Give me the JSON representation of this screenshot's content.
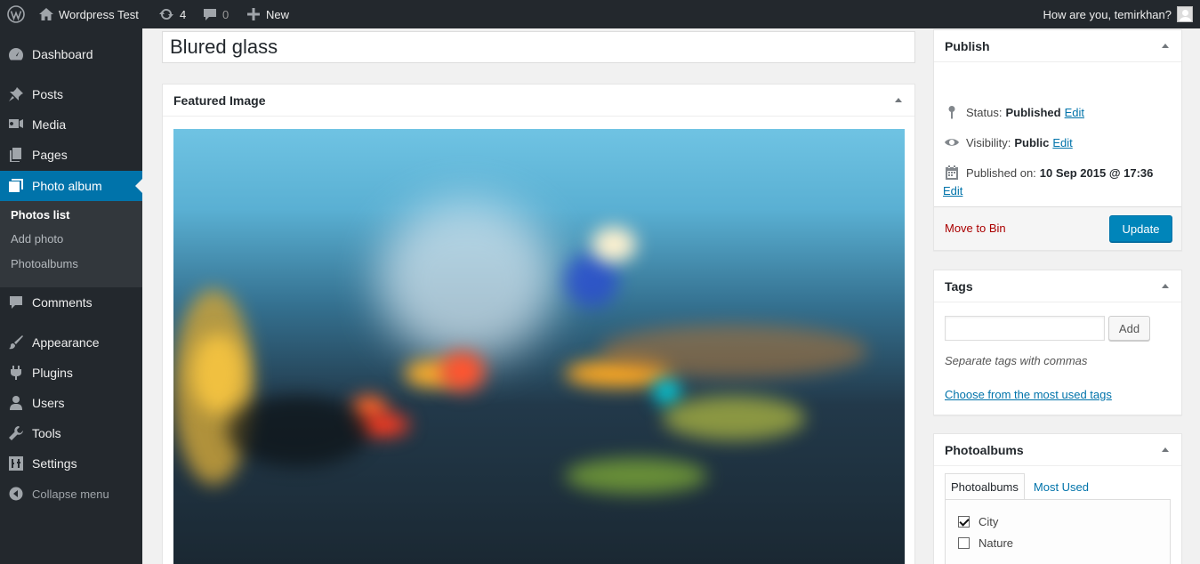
{
  "adminbar": {
    "site_name": "Wordpress Test",
    "updates_count": "4",
    "comments_count": "0",
    "new_label": "New",
    "howdy": "How are you, temirkhan?"
  },
  "sidebar": {
    "items": [
      {
        "label": "Dashboard",
        "icon": "dashboard-icon"
      },
      {
        "label": "Posts",
        "icon": "pushpin-icon"
      },
      {
        "label": "Media",
        "icon": "media-icon"
      },
      {
        "label": "Pages",
        "icon": "pages-icon"
      },
      {
        "label": "Photo album",
        "icon": "photo-album-icon",
        "current": true
      },
      {
        "label": "Comments",
        "icon": "comment-icon"
      },
      {
        "label": "Appearance",
        "icon": "paintbrush-icon"
      },
      {
        "label": "Plugins",
        "icon": "plugin-icon"
      },
      {
        "label": "Users",
        "icon": "users-icon"
      },
      {
        "label": "Tools",
        "icon": "wrench-icon"
      },
      {
        "label": "Settings",
        "icon": "settings-icon"
      }
    ],
    "submenu": [
      "Photos list",
      "Add photo",
      "Photoalbums"
    ],
    "collapse_label": "Collapse menu"
  },
  "post": {
    "title": "Blured glass"
  },
  "featured_image": {
    "heading": "Featured Image"
  },
  "publish": {
    "heading": "Publish",
    "status_label": "Status:",
    "status_value": "Published",
    "visibility_label": "Visibility:",
    "visibility_value": "Public",
    "published_on_label": "Published on:",
    "published_on_value": "10 Sep 2015 @ 17:36",
    "edit_label": "Edit",
    "move_to_bin": "Move to Bin",
    "update_button": "Update"
  },
  "tags": {
    "heading": "Tags",
    "input_value": "",
    "add_button": "Add",
    "hint": "Separate tags with commas",
    "choose_link": "Choose from the most used tags"
  },
  "photoalbums": {
    "heading": "Photoalbums",
    "tabs": [
      "Photoalbums",
      "Most Used"
    ],
    "categories": [
      {
        "label": "City",
        "checked": true
      },
      {
        "label": "Nature",
        "checked": false
      }
    ]
  },
  "colors": {
    "accent": "#0073aa",
    "adminbar_bg": "#23282d",
    "current_menu": "#0073aa",
    "update_button": "#0085ba",
    "move_to_bin": "#aa0000"
  }
}
